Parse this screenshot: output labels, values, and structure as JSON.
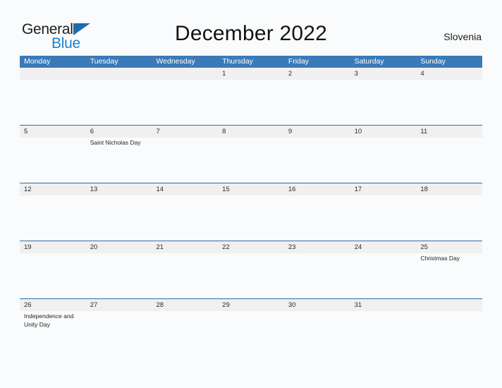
{
  "brand": {
    "line1": "General",
    "line2": "Blue",
    "triangle_icon": "triangle-logo-icon",
    "line1_color": "#1c1c1c",
    "line2_color": "#1d7fd0",
    "triangle_color": "#1d6cb0"
  },
  "header": {
    "title": "December 2022",
    "country": "Slovenia"
  },
  "theme": {
    "header_bar_color": "#3a7ab8",
    "date_band_color": "#f0f0f0",
    "row_divider_color": "#2d6da4",
    "page_background": "#fafbfc",
    "weekday_text_color": "#ffffff"
  },
  "calendar": {
    "weekdays": [
      "Monday",
      "Tuesday",
      "Wednesday",
      "Thursday",
      "Friday",
      "Saturday",
      "Sunday"
    ],
    "weeks": [
      [
        {
          "day": "",
          "events": []
        },
        {
          "day": "",
          "events": []
        },
        {
          "day": "",
          "events": []
        },
        {
          "day": "1",
          "events": []
        },
        {
          "day": "2",
          "events": []
        },
        {
          "day": "3",
          "events": []
        },
        {
          "day": "4",
          "events": []
        }
      ],
      [
        {
          "day": "5",
          "events": []
        },
        {
          "day": "6",
          "events": [
            "Saint Nicholas Day"
          ]
        },
        {
          "day": "7",
          "events": []
        },
        {
          "day": "8",
          "events": []
        },
        {
          "day": "9",
          "events": []
        },
        {
          "day": "10",
          "events": []
        },
        {
          "day": "11",
          "events": []
        }
      ],
      [
        {
          "day": "12",
          "events": []
        },
        {
          "day": "13",
          "events": []
        },
        {
          "day": "14",
          "events": []
        },
        {
          "day": "15",
          "events": []
        },
        {
          "day": "16",
          "events": []
        },
        {
          "day": "17",
          "events": []
        },
        {
          "day": "18",
          "events": []
        }
      ],
      [
        {
          "day": "19",
          "events": []
        },
        {
          "day": "20",
          "events": []
        },
        {
          "day": "21",
          "events": []
        },
        {
          "day": "22",
          "events": []
        },
        {
          "day": "23",
          "events": []
        },
        {
          "day": "24",
          "events": []
        },
        {
          "day": "25",
          "events": [
            "Christmas Day"
          ]
        }
      ],
      [
        {
          "day": "26",
          "events": [
            "Independence and Unity Day"
          ]
        },
        {
          "day": "27",
          "events": []
        },
        {
          "day": "28",
          "events": []
        },
        {
          "day": "29",
          "events": []
        },
        {
          "day": "30",
          "events": []
        },
        {
          "day": "31",
          "events": []
        },
        {
          "day": "",
          "events": []
        }
      ]
    ]
  }
}
